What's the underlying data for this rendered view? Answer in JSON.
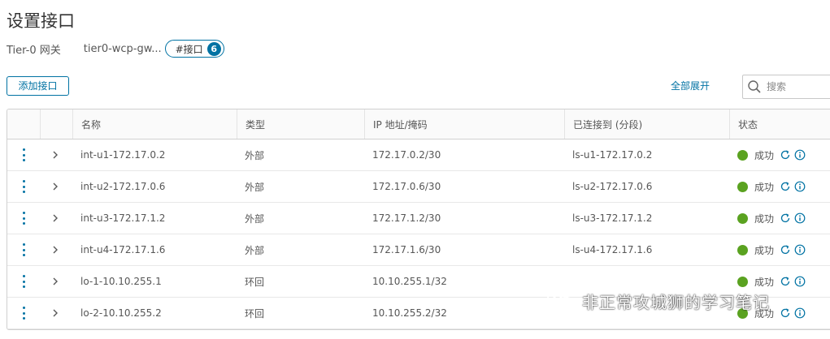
{
  "page": {
    "title": "设置接口"
  },
  "gateway": {
    "type_label": "Tier-0 网关",
    "name": "tier0-wcp-gw...",
    "interfaces_label": "#接口",
    "interfaces_count": "6"
  },
  "toolbar": {
    "add_label": "添加接口",
    "expand_all_label": "全部展开",
    "search_placeholder": "搜索"
  },
  "table": {
    "columns": [
      "名称",
      "类型",
      "IP 地址/掩码",
      "已连接到 (分段)",
      "状态"
    ],
    "rows": [
      {
        "name": "int-u1-172.17.0.2",
        "type": "外部",
        "ip": "172.17.0.2/30",
        "connected": "ls-u1-172.17.0.2",
        "status": "成功"
      },
      {
        "name": "int-u2-172.17.0.6",
        "type": "外部",
        "ip": "172.17.0.6/30",
        "connected": "ls-u2-172.17.0.6",
        "status": "成功"
      },
      {
        "name": "int-u3-172.17.1.2",
        "type": "外部",
        "ip": "172.17.1.2/30",
        "connected": "ls-u3-172.17.1.2",
        "status": "成功"
      },
      {
        "name": "int-u4-172.17.1.6",
        "type": "外部",
        "ip": "172.17.1.6/30",
        "connected": "ls-u4-172.17.1.6",
        "status": "成功"
      },
      {
        "name": "lo-1-10.10.255.1",
        "type": "环回",
        "ip": "10.10.255.1/32",
        "connected": "",
        "status": "成功"
      },
      {
        "name": "lo-2-10.10.255.2",
        "type": "环回",
        "ip": "10.10.255.2/32",
        "connected": "",
        "status": "成功"
      }
    ]
  },
  "watermark": {
    "text": "非正常攻城狮的学习笔记"
  },
  "colors": {
    "accent": "#0072a3",
    "success": "#5aa220",
    "border": "#d0d0d0"
  },
  "icons": {
    "row_menu": "kebab-icon",
    "row_expand": "chevron-right-icon",
    "refresh": "refresh-icon",
    "info": "info-icon",
    "search": "search-icon"
  }
}
